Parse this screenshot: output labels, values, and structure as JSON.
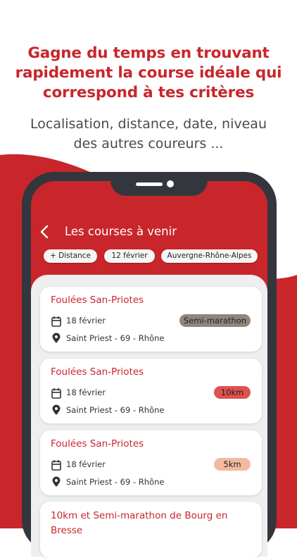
{
  "headline": {
    "line1": "Gagne du temps en trouvant",
    "line2": "rapidement la course idéale qui",
    "line3": "correspond à tes critères"
  },
  "subline": {
    "line1": "Localisation, distance, date, niveau",
    "line2": "des autres coureurs ..."
  },
  "app": {
    "title": "Les courses à venir",
    "back_icon": "chevron-left-icon",
    "filters": [
      {
        "label": "+ Distance"
      },
      {
        "label": "12 février"
      },
      {
        "label": "Auvergne-Rhône-Alpes"
      }
    ],
    "races": [
      {
        "name": "Foulées San-Priotes",
        "date": "18 février",
        "location": "Saint Priest - 69 - Rhône",
        "distance": "Semi-marathon",
        "badge_color": "#8f877c"
      },
      {
        "name": "Foulées San-Priotes",
        "date": "18 février",
        "location": "Saint Priest - 69 - Rhône",
        "distance": "10km",
        "badge_color": "#de5250"
      },
      {
        "name": "Foulées San-Priotes",
        "date": "18 février",
        "location": "Saint Priest - 69 - Rhône",
        "distance": "5km",
        "badge_color": "#f3b9a2"
      },
      {
        "name": "10km et Semi-marathon de Bourg en Bresse"
      }
    ]
  },
  "colors": {
    "accent": "#c8262b",
    "phone_frame": "#33373d",
    "list_background": "#efefef"
  },
  "icons": {
    "date": "calendar-icon",
    "location": "location-pin-icon"
  }
}
